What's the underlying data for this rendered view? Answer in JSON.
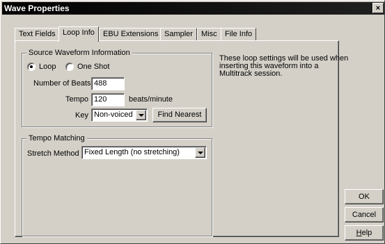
{
  "window": {
    "title": "Wave Properties",
    "close_glyph": "×"
  },
  "tabs": [
    {
      "label": "Text Fields",
      "active": false
    },
    {
      "label": "Loop Info",
      "active": true
    },
    {
      "label": "EBU Extensions",
      "active": false
    },
    {
      "label": "Sampler",
      "active": false
    },
    {
      "label": "Misc",
      "active": false
    },
    {
      "label": "File Info",
      "active": false
    }
  ],
  "source_group": {
    "title": "Source Waveform Information",
    "loop_label": "Loop",
    "one_shot_label": "One Shot",
    "selected": "Loop",
    "beats_label": "Number of Beats",
    "beats_value": "488",
    "tempo_label": "Tempo",
    "tempo_value": "120",
    "tempo_unit": "beats/minute",
    "key_label": "Key",
    "key_value": "Non-voiced",
    "find_nearest_label": "Find Nearest"
  },
  "tempo_group": {
    "title": "Tempo Matching",
    "stretch_label": "Stretch Method",
    "stretch_value": "Fixed Length (no stretching)"
  },
  "note": "These loop settings will be used when inserting this waveform into a Multitrack session.",
  "buttons": {
    "ok": "OK",
    "cancel": "Cancel",
    "help_first": "H",
    "help_rest": "elp"
  }
}
